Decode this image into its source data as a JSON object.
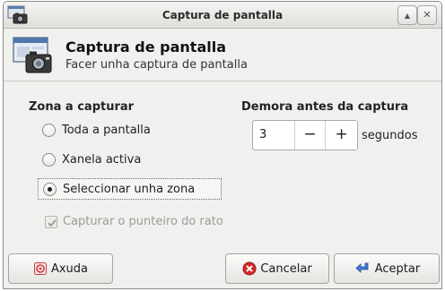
{
  "window": {
    "title": "Captura de pantalla",
    "buttons": {
      "up": "▲",
      "close": "✕"
    }
  },
  "header": {
    "title": "Captura de pantalla",
    "subtitle": "Facer unha captura de pantalla"
  },
  "capture_zone": {
    "title": "Zona a capturar",
    "options": [
      {
        "label": "Toda a pantalla",
        "checked": false
      },
      {
        "label": "Xanela activa",
        "checked": false
      },
      {
        "label": "Seleccionar unha zona",
        "checked": true
      }
    ],
    "pointer_checkbox": {
      "label": "Capturar o punteiro do rato",
      "checked": true,
      "enabled": false
    }
  },
  "delay": {
    "title": "Demora antes da captura",
    "value": "3",
    "minus": "−",
    "plus": "+",
    "unit": "segundos"
  },
  "footer": {
    "help_label": "Axuda",
    "cancel_label": "Cancelar",
    "accept_label": "Aceptar"
  },
  "icons": {
    "app": "camera-screenshot-icon",
    "help": "help-icon",
    "cancel": "cancel-icon",
    "accept": "accept-arrow-icon"
  },
  "colors": {
    "window_bg": "#f0f0ee",
    "cancel_red": "#d42a2a",
    "accept_blue": "#3c7bd6"
  }
}
